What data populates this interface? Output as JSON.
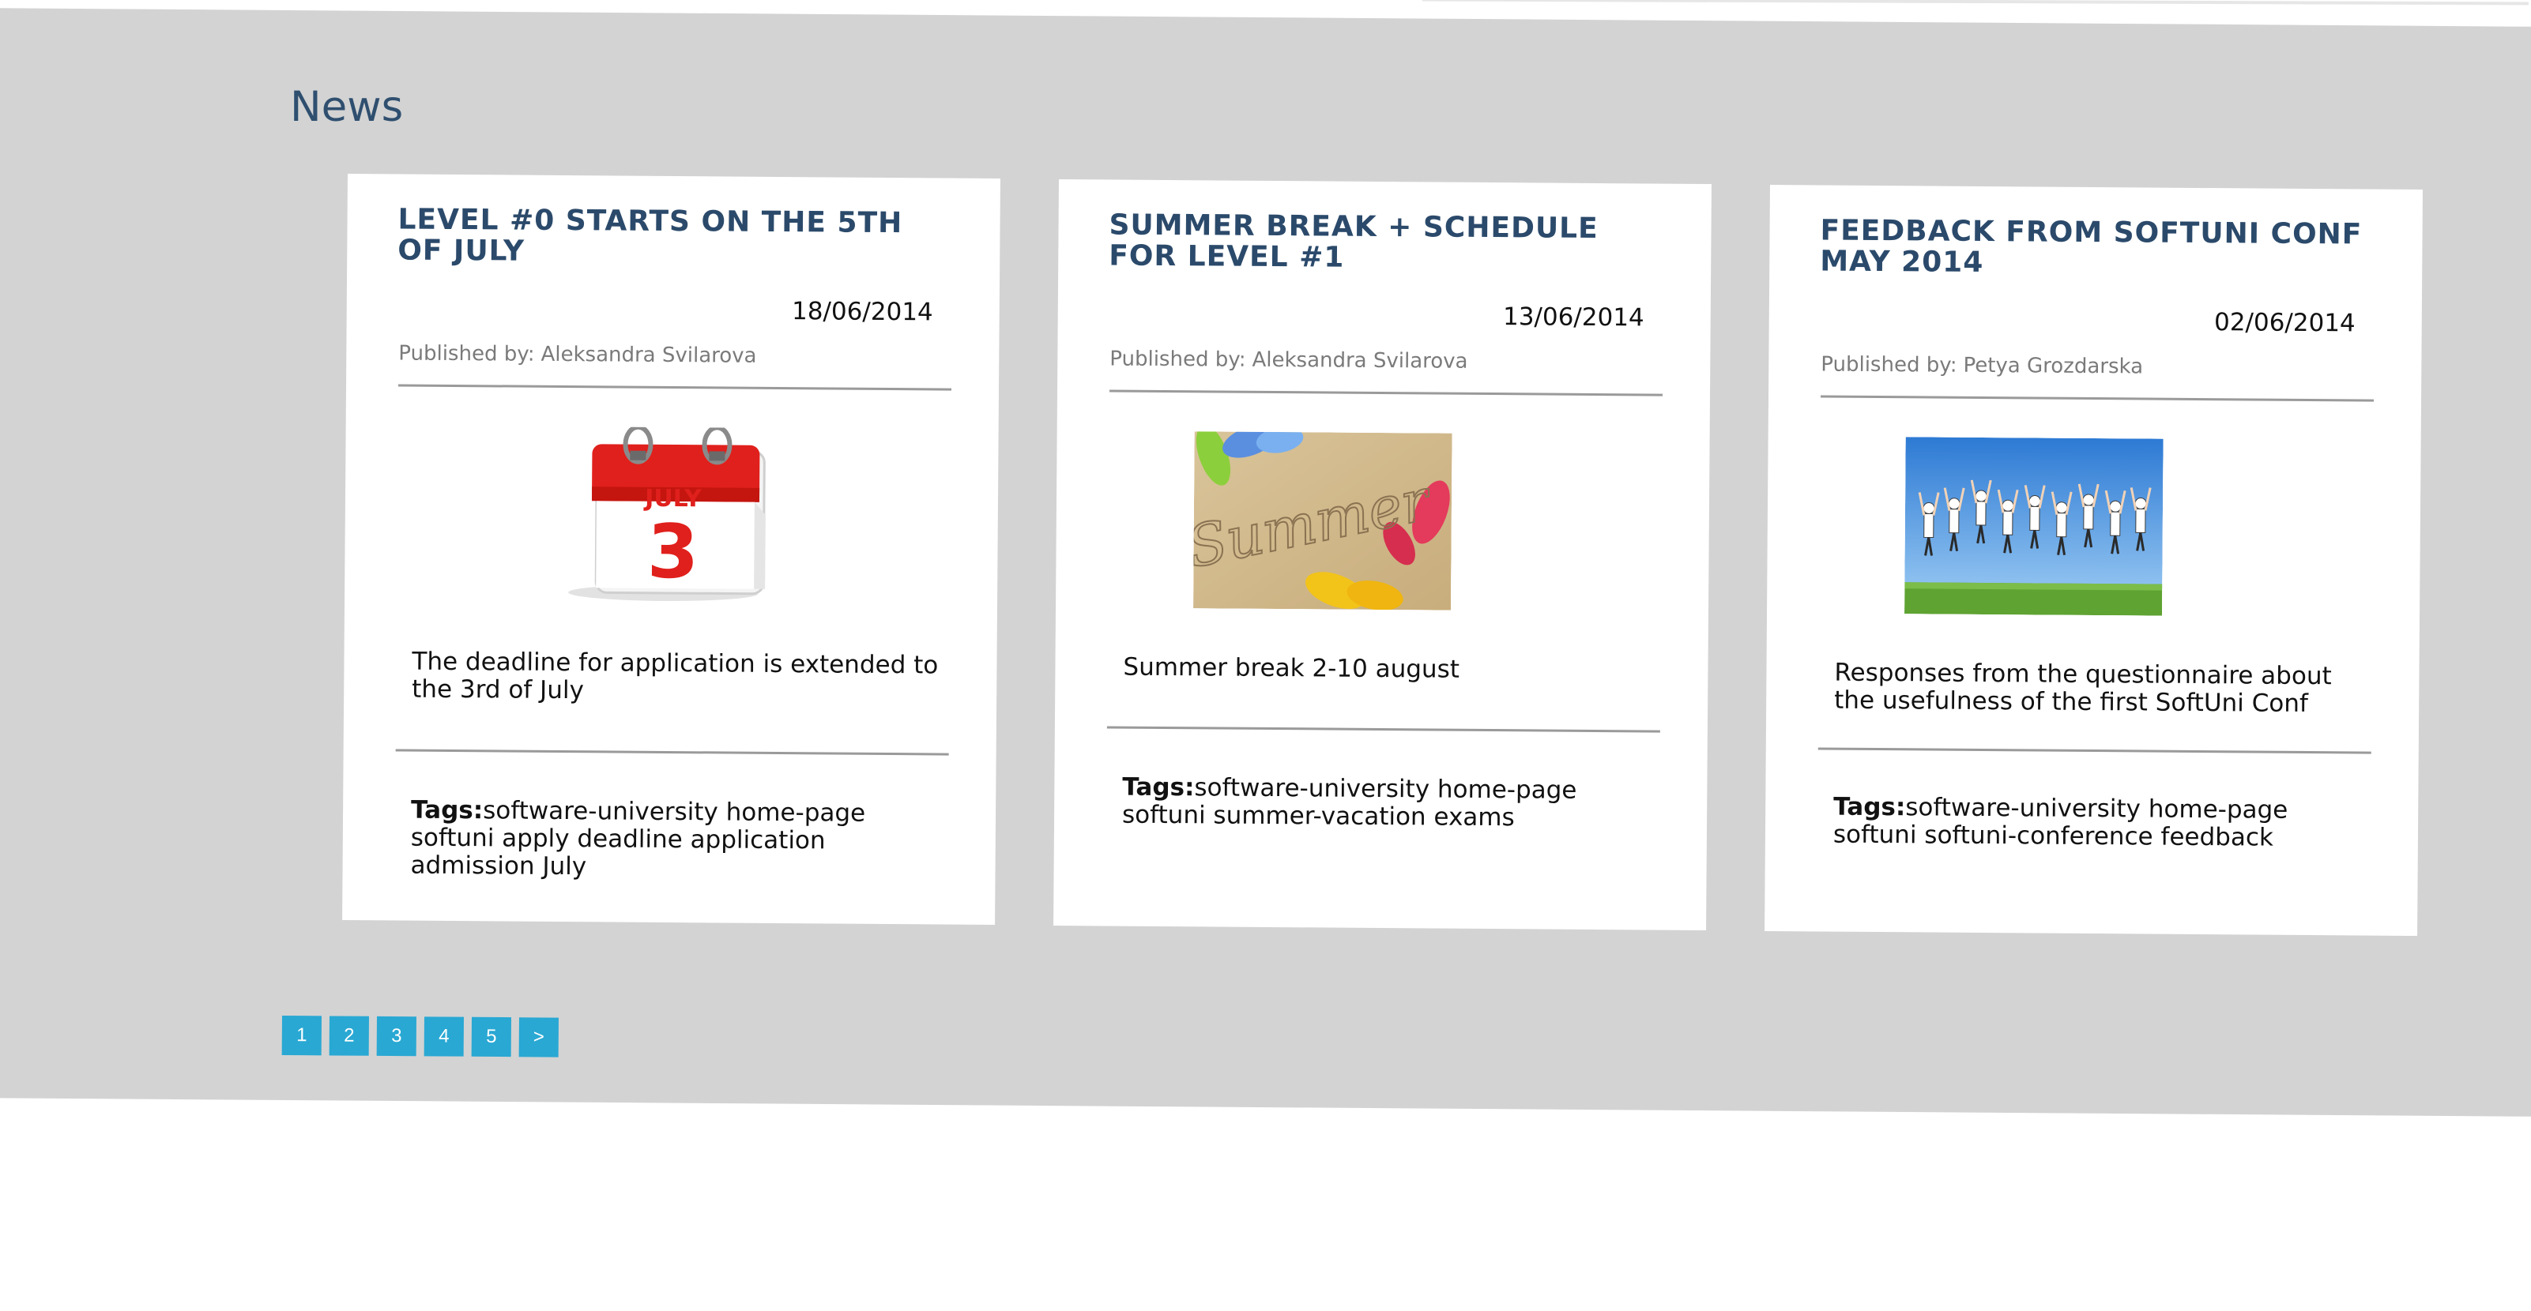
{
  "section": {
    "heading": "News"
  },
  "colors": {
    "band": "#d3d3d3",
    "title": "#2b4a6b",
    "pager": "#29a8d3"
  },
  "news": [
    {
      "title": "LEVEL #0 STARTS ON THE 5TH OF JULY",
      "date": "18/06/2014",
      "author_label": "Published by:",
      "author": "Aleksandra Svilarova",
      "image_icon": "calendar-july-3-image",
      "image_month": "JULY",
      "image_day": "3",
      "body": "The deadline for application is extended to the 3rd of July",
      "tags_label": "Tags:",
      "tags": "software-university home-page softuni apply deadline application admission July"
    },
    {
      "title": "SUMMER BREAK + SCHEDULE FOR LEVEL #1",
      "date": "13/06/2014",
      "author_label": "Published by:",
      "author": "Aleksandra Svilarova",
      "image_icon": "summer-beach-image",
      "image_text": "Summer",
      "body": "Summer break 2-10 august",
      "tags_label": "Tags:",
      "tags": "software-university home-page softuni summer-vacation exams"
    },
    {
      "title": "FEEDBACK FROM SOFTUNI CONF MAY 2014",
      "date": "02/06/2014",
      "author_label": "Published by:",
      "author": "Petya Grozdarska",
      "image_icon": "people-jumping-image",
      "body": "Responses from the questionnaire about the usefulness of the first SoftUni Conf",
      "tags_label": "Tags:",
      "tags": "software-university home-page softuni softuni-conference feedback"
    }
  ],
  "pagination": {
    "pages": [
      "1",
      "2",
      "3",
      "4",
      "5"
    ],
    "next": ">"
  }
}
